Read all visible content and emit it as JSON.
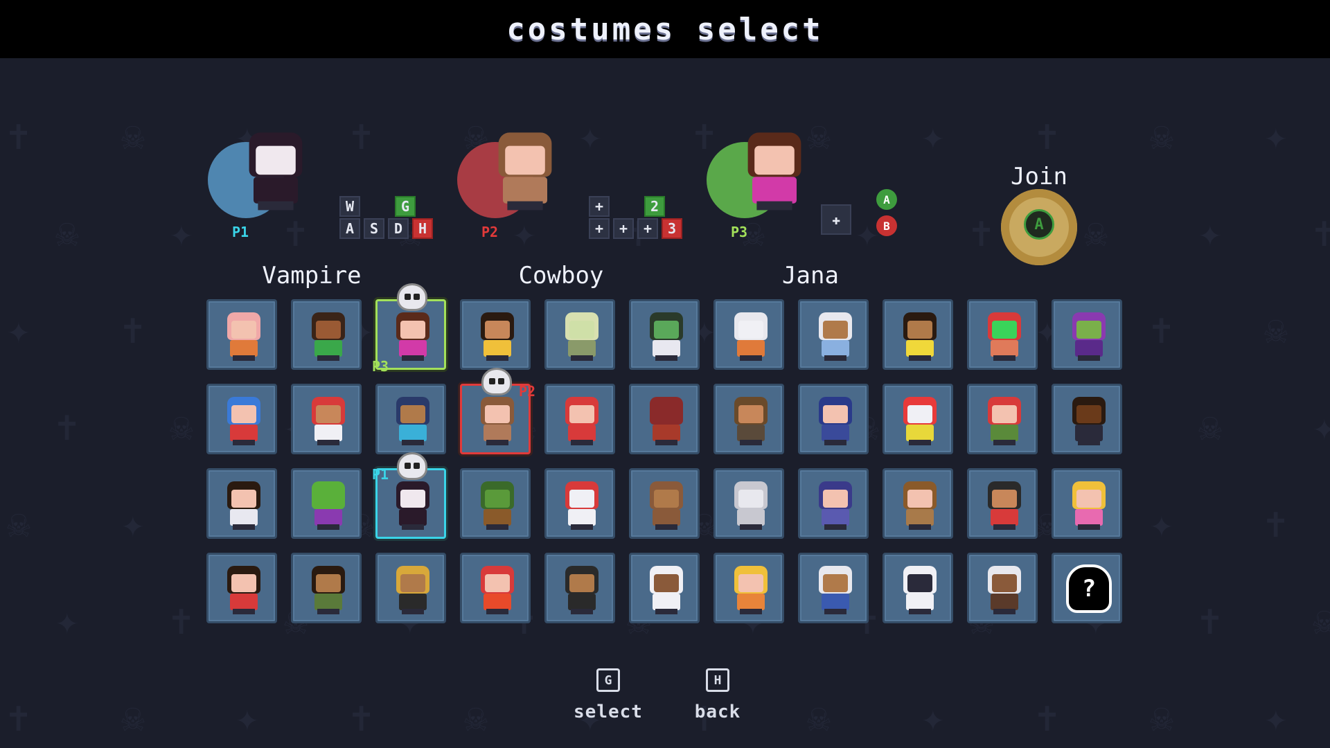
{
  "title": "costumes select",
  "players": [
    {
      "tag": "P1",
      "name": "Vampire",
      "color": "#3ad4e8",
      "bubble": "#4f86b0",
      "keys": [
        {
          "k": "W",
          "style": ""
        },
        {
          "k": "G",
          "style": "green"
        },
        {
          "k": "A",
          "style": ""
        },
        {
          "k": "S",
          "style": ""
        },
        {
          "k": "D",
          "style": ""
        },
        {
          "k": "H",
          "style": "red"
        }
      ]
    },
    {
      "tag": "P2",
      "name": "Cowboy",
      "color": "#e23a3a",
      "bubble": "#a83c44",
      "keys": [
        {
          "k": "+",
          "style": ""
        },
        {
          "k": "2",
          "style": "green"
        },
        {
          "k": "+",
          "style": ""
        },
        {
          "k": "+",
          "style": ""
        },
        {
          "k": "+",
          "style": ""
        },
        {
          "k": "3",
          "style": "red"
        }
      ]
    },
    {
      "tag": "P3",
      "name": "Jana",
      "color": "#a3e15a",
      "bubble": "#5aa84a",
      "keys": [
        {
          "k": "A",
          "style": "green"
        },
        {
          "k": "B",
          "style": "red"
        }
      ]
    }
  ],
  "join": {
    "label": "Join",
    "button": "A"
  },
  "grid": {
    "rows": [
      [
        {
          "name": "bald-kid",
          "hair": "#f0a8a8",
          "skin": "#f3c2b0",
          "body": "#e07a3a"
        },
        {
          "name": "green-shirt-kid",
          "hair": "#3a2418",
          "skin": "#9a5a34",
          "body": "#3aa84a"
        },
        {
          "name": "jana-costume",
          "hair": "#5a2a1a",
          "skin": "#f3c2b0",
          "body": "#d23aa8",
          "sel": "p3",
          "tag": "P3"
        },
        {
          "name": "flower-girl",
          "hair": "#2a1a10",
          "skin": "#c8875a",
          "body": "#f0c03a"
        },
        {
          "name": "zombie",
          "hair": "#d8e0b0",
          "skin": "#cfe0a8",
          "body": "#8a9a6a"
        },
        {
          "name": "frankenstein",
          "hair": "#2a3a2a",
          "skin": "#5aa85a",
          "body": "#e8e8f0"
        },
        {
          "name": "skeleton",
          "hair": "#e8e8ee",
          "skin": "#f0f0f5",
          "body": "#e07a3a"
        },
        {
          "name": "doctor",
          "hair": "#e8e8ee",
          "skin": "#b07a4a",
          "body": "#8ab0e0"
        },
        {
          "name": "soccer-kid",
          "hair": "#2a1a10",
          "skin": "#b07a4a",
          "body": "#f0d83a"
        },
        {
          "name": "luchador",
          "hair": "#d83a3a",
          "skin": "#3ad45a",
          "body": "#e07a5a"
        },
        {
          "name": "witch",
          "hair": "#8a3ab0",
          "skin": "#7ab04a",
          "body": "#5a2a8a"
        }
      ],
      [
        {
          "name": "cartman-kid",
          "hair": "#3a7ad8",
          "skin": "#f3c2b0",
          "body": "#d83a3a"
        },
        {
          "name": "karate-fighter",
          "hair": "#d83a3a",
          "skin": "#c8875a",
          "body": "#f0f0f5"
        },
        {
          "name": "blue-hood-girl",
          "hair": "#2a3a6a",
          "skin": "#b07a4a",
          "body": "#3ab0d8"
        },
        {
          "name": "cowboy",
          "hair": "#8a5a3a",
          "skin": "#f3c2b0",
          "body": "#b07a5a",
          "sel": "p2",
          "tag": "P2"
        },
        {
          "name": "red-riding-hood",
          "hair": "#d83a3a",
          "skin": "#f3c2b0",
          "body": "#d83a3a"
        },
        {
          "name": "ninja",
          "hair": "#8a2a2a",
          "skin": "#8a2a2a",
          "body": "#a83a2a"
        },
        {
          "name": "detective",
          "hair": "#6a4a2a",
          "skin": "#c8875a",
          "body": "#5a4a3a"
        },
        {
          "name": "police-officer",
          "hair": "#2a3a8a",
          "skin": "#f3c2b0",
          "body": "#3a4a9a"
        },
        {
          "name": "clown",
          "hair": "#e83a3a",
          "skin": "#f0f0f5",
          "body": "#e8d83a"
        },
        {
          "name": "gnome",
          "hair": "#d83a3a",
          "skin": "#f3c2b0",
          "body": "#5a8a3a"
        },
        {
          "name": "agent",
          "hair": "#2a1a10",
          "skin": "#6a3a1a",
          "body": "#2a2a3a"
        }
      ],
      [
        {
          "name": "scientist",
          "hair": "#2a1a10",
          "skin": "#f3c2b0",
          "body": "#e8e8f0"
        },
        {
          "name": "alien",
          "hair": "#5ab03a",
          "skin": "#5ab03a",
          "body": "#8a3ab0"
        },
        {
          "name": "vampire",
          "hair": "#2a1a2a",
          "skin": "#f0e8ee",
          "body": "#2a1a2a",
          "sel": "p1",
          "tag": "P1"
        },
        {
          "name": "orc",
          "hair": "#3a6a2a",
          "skin": "#5a9a3a",
          "body": "#8a5a2a"
        },
        {
          "name": "chicken",
          "hair": "#d83a3a",
          "skin": "#f0f0f5",
          "body": "#f0f0f5"
        },
        {
          "name": "bear",
          "hair": "#8a5a3a",
          "skin": "#b07a4a",
          "body": "#8a5a3a"
        },
        {
          "name": "knight",
          "hair": "#c8c8d0",
          "skin": "#e8e8ee",
          "body": "#c8c8d0"
        },
        {
          "name": "wizard",
          "hair": "#3a3a8a",
          "skin": "#f3c2b0",
          "body": "#5a5ab0"
        },
        {
          "name": "viking",
          "hair": "#8a5a2a",
          "skin": "#f3c2b0",
          "body": "#a87a4a"
        },
        {
          "name": "pirate",
          "hair": "#2a2a2a",
          "skin": "#c8875a",
          "body": "#d83a3a"
        },
        {
          "name": "princess",
          "hair": "#f0c03a",
          "skin": "#f3c2b0",
          "body": "#e86ab0"
        }
      ],
      [
        {
          "name": "nerd-girl",
          "hair": "#2a1a10",
          "skin": "#f3c2b0",
          "body": "#d83a3a"
        },
        {
          "name": "hiker",
          "hair": "#2a1a10",
          "skin": "#b07a4a",
          "body": "#5a7a3a"
        },
        {
          "name": "mariachi",
          "hair": "#d8a83a",
          "skin": "#b07a4a",
          "body": "#2a2a2a"
        },
        {
          "name": "firefighter",
          "hair": "#d83a3a",
          "skin": "#f3c2b0",
          "body": "#e84a2a"
        },
        {
          "name": "magician",
          "hair": "#2a2a2a",
          "skin": "#b07a4a",
          "body": "#2a2a2a"
        },
        {
          "name": "chef",
          "hair": "#f0f0f5",
          "skin": "#8a5a3a",
          "body": "#f0f0f5"
        },
        {
          "name": "construction-worker",
          "hair": "#f0c03a",
          "skin": "#f3c2b0",
          "body": "#e8843a"
        },
        {
          "name": "granny",
          "hair": "#e8e8ee",
          "skin": "#b07a4a",
          "body": "#3a5ab0"
        },
        {
          "name": "astronaut",
          "hair": "#f0f0f5",
          "skin": "#2a2a3a",
          "body": "#f0f0f5"
        },
        {
          "name": "biker",
          "hair": "#e8e8ee",
          "skin": "#8a5a3a",
          "body": "#5a3a2a"
        },
        {
          "name": "mystery",
          "mystery": true,
          "label": "?"
        }
      ]
    ]
  },
  "footer": [
    {
      "key": "G",
      "label": "select"
    },
    {
      "key": "H",
      "label": "back"
    }
  ]
}
